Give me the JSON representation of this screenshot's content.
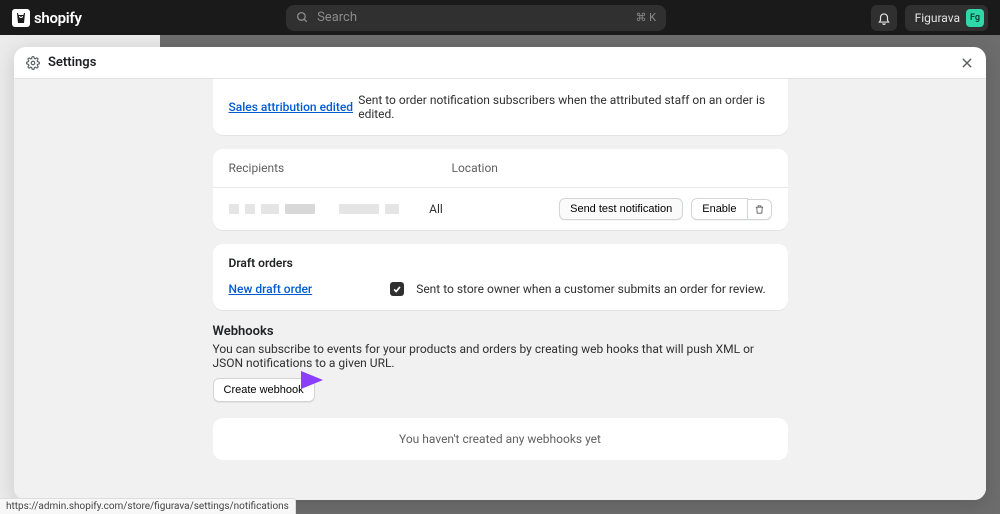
{
  "topbar": {
    "brand": "shopify",
    "search_placeholder": "Search",
    "search_shortcut": "⌘ K",
    "user_name": "Figurava",
    "user_initials": "Fg"
  },
  "modal": {
    "title": "Settings"
  },
  "sales_attr": {
    "link": "Sales attribution edited",
    "desc": "Sent to order notification subscribers when the attributed staff on an order is edited."
  },
  "recipients": {
    "col1": "Recipients",
    "col2": "Location",
    "location_value": "All",
    "send_test": "Send test notification",
    "enable": "Enable"
  },
  "draft": {
    "title": "Draft orders",
    "link": "New draft order",
    "desc": "Sent to store owner when a customer submits an order for review."
  },
  "webhooks": {
    "title": "Webhooks",
    "desc": "You can subscribe to events for your products and orders by creating web hooks that will push XML or JSON notifications to a given URL.",
    "create_button": "Create webhook",
    "empty": "You haven't created any webhooks yet"
  },
  "status_url": "https://admin.shopify.com/store/figurava/settings/notifications"
}
